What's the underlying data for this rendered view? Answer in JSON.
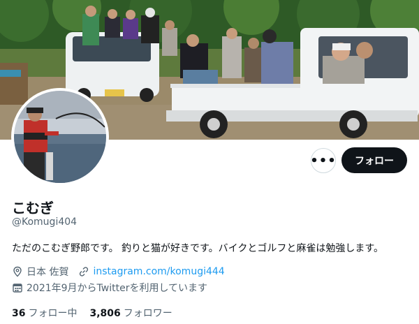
{
  "profile": {
    "display_name": "こむぎ",
    "handle": "@Komugi404",
    "bio": "ただのこむぎ野郎です。 釣りと猫が好きです。バイクとゴルフと麻雀は勉強します。",
    "location": "日本 佐賀",
    "link": "instagram.com/komugi444",
    "joined": "2021年9月からTwitterを利用しています",
    "following_count": "36",
    "following_label": "フォロー中",
    "followers_count": "3,806",
    "followers_label": "フォロワー"
  },
  "actions": {
    "more_label": "•••",
    "follow_label": "フォロー"
  },
  "icons": {
    "location": "location-pin-icon",
    "link": "link-icon",
    "calendar": "calendar-icon",
    "more": "more-icon"
  },
  "colors": {
    "text": "#0f1419",
    "secondary": "#536471",
    "link": "#1d9bf0",
    "follow_button": "#0f1419"
  }
}
